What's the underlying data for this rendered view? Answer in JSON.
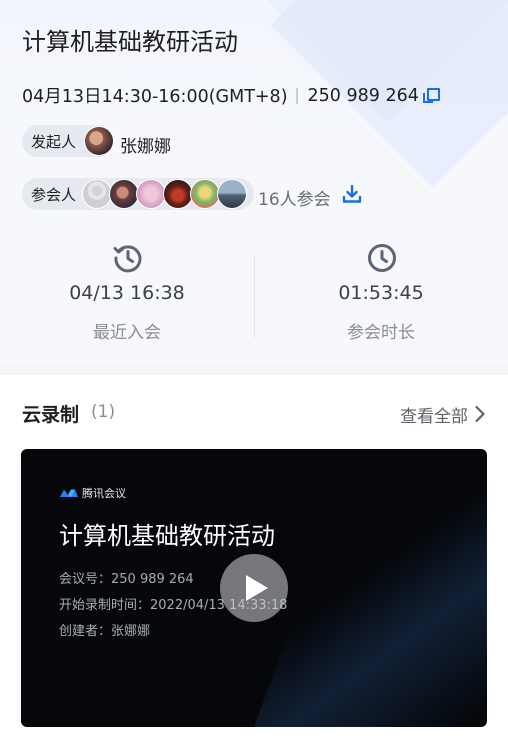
{
  "meeting": {
    "title": "计算机基础教研活动",
    "time": "04月13日14:30-16:00(GMT+8)",
    "meeting_id": "250 989 264"
  },
  "host": {
    "label": "发起人",
    "name": "张娜娜"
  },
  "participants": {
    "label": "参会人",
    "count_text": "16人参会"
  },
  "stats": {
    "last_join_value": "04/13 16:38",
    "last_join_label": "最近入会",
    "duration_value": "01:53:45",
    "duration_label": "参会时长"
  },
  "recordings": {
    "title": "云录制",
    "count": "(1)",
    "view_all": "查看全部"
  },
  "video": {
    "brand": "腾讯会议",
    "title": "计算机基础教研活动",
    "line1": "会议号：250 989 264",
    "line2": "开始录制时间：2022/04/13 14:33:18",
    "line3": "创建者：张娜娜"
  },
  "colors": {
    "accent": "#1a6cf2",
    "clock": "#5b6577"
  }
}
